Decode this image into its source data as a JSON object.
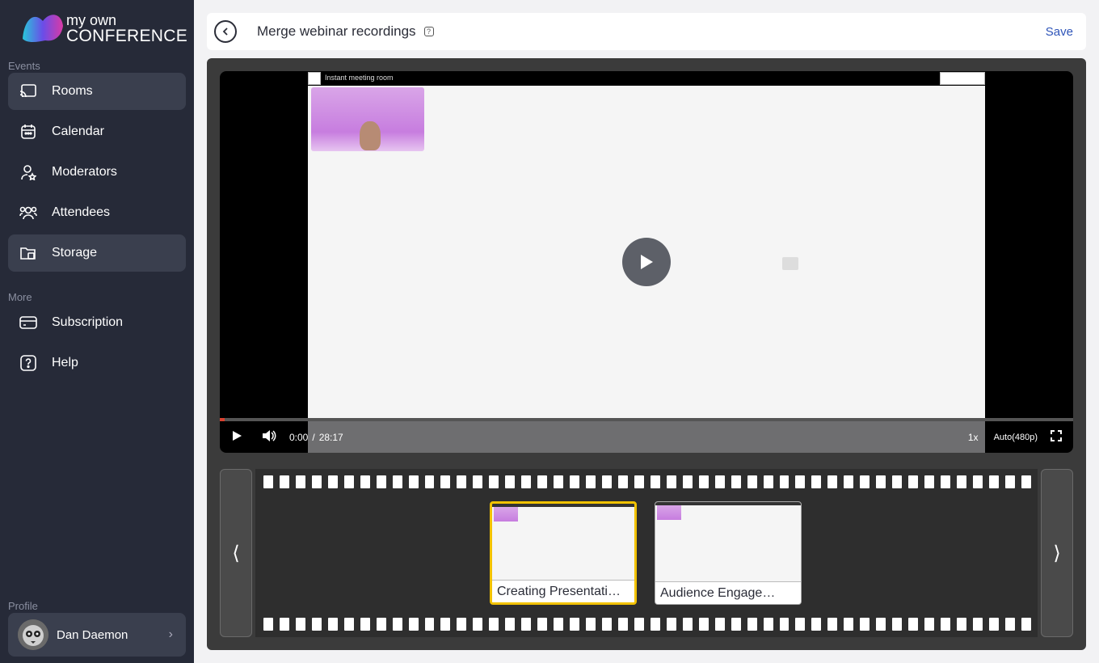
{
  "logo": {
    "line1": "my own",
    "line2": "CONFERENCE"
  },
  "sidebar": {
    "section_events": "Events",
    "section_more": "More",
    "section_profile": "Profile",
    "items": [
      {
        "label": "Rooms",
        "icon": "cast-icon"
      },
      {
        "label": "Calendar",
        "icon": "calendar-icon"
      },
      {
        "label": "Moderators",
        "icon": "moderator-icon"
      },
      {
        "label": "Attendees",
        "icon": "attendees-icon"
      },
      {
        "label": "Storage",
        "icon": "folder-icon"
      },
      {
        "label": "Subscription",
        "icon": "credit-card-icon"
      },
      {
        "label": "Help",
        "icon": "help-icon"
      }
    ],
    "profile_name": "Dan Daemon"
  },
  "header": {
    "title": "Merge webinar recordings",
    "save_label": "Save"
  },
  "video": {
    "room_label": "Instant meeting room",
    "current_time": "0:00",
    "separator": "/",
    "duration": "28:17",
    "speed": "1x",
    "quality": "Auto(480p)",
    "progress": 0.0
  },
  "filmstrip": {
    "prev": "⟨",
    "next": "⟩",
    "recordings": [
      {
        "title": "Creating Presentati…",
        "selected": true
      },
      {
        "title": "Audience Engage…",
        "selected": false
      }
    ]
  },
  "colors": {
    "sidebar_bg": "#262a38",
    "accent": "#2f55b9",
    "selection": "#f2c200"
  }
}
